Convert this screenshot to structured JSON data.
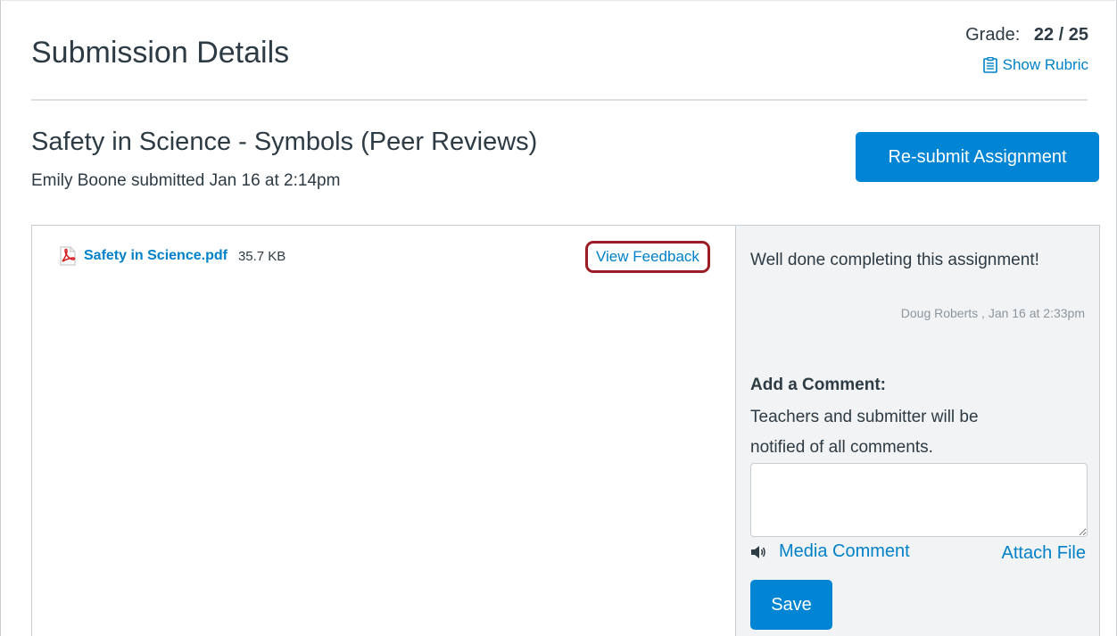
{
  "header": {
    "title": "Submission Details",
    "grade_label": "Grade:",
    "grade_value": "22 / 25",
    "show_rubric_label": "Show Rubric"
  },
  "assignment": {
    "title": "Safety in Science - Symbols (Peer Reviews)",
    "submitted_text": "Emily Boone submitted Jan 16 at 2:14pm",
    "resubmit_label": "Re-submit Assignment"
  },
  "file": {
    "name": "Safety in Science.pdf",
    "size": "35.7 KB",
    "view_feedback_label": "View Feedback",
    "icon": "pdf-icon"
  },
  "comments": {
    "existing": {
      "text": "Well done completing this assignment!",
      "meta": "Doug Roberts , Jan 16 at 2:33pm"
    },
    "add_heading": "Add a Comment:",
    "notify_text": "Teachers and submitter will be notified of all comments.",
    "textarea_value": "",
    "media_comment_label": "Media Comment",
    "attach_file_label": "Attach File",
    "save_label": "Save"
  },
  "colors": {
    "accent": "#0084d4",
    "link": "#0081c8",
    "highlight_border": "#9b1c24",
    "pdf_red": "#d61a1a"
  }
}
